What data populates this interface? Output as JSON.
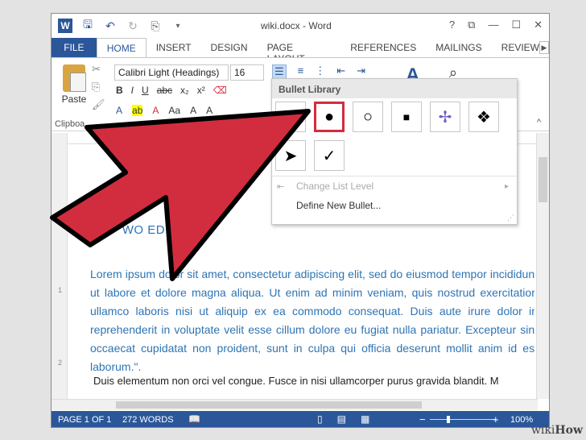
{
  "titlebar": {
    "title": "wiki.docx - Word",
    "help": "?",
    "restore": "⧉",
    "minimize": "—",
    "maximize": "☐",
    "close": "✕"
  },
  "tabs": [
    "FILE",
    "HOME",
    "INSERT",
    "DESIGN",
    "PAGE LAYOUT",
    "REFERENCES",
    "MAILINGS",
    "REVIEW"
  ],
  "ribbon": {
    "paste_label": "Paste",
    "clipboard_label": "Clipboa",
    "font_name": "Calibri Light (Headings)",
    "font_size": "16",
    "format_buttons": [
      "B",
      "I",
      "U",
      "abc",
      "x₂",
      "x²"
    ],
    "format_row2": [
      "A",
      "ab",
      "A",
      "Aa",
      "A",
      "A"
    ]
  },
  "dropdown": {
    "title": "Bullet Library",
    "bullets": [
      "",
      "●",
      "○",
      "■",
      "✢",
      "❖",
      "➤",
      "✓"
    ],
    "selected_index": 1,
    "change_list_level": "Change List Level",
    "define_new_bullet": "Define New Bullet..."
  },
  "document": {
    "heading": "WO        ED",
    "paragraph": "Lorem ipsum dolor sit amet, consectetur adipiscing elit, sed do eiusmod tempor incididunt ut labore et dolore magna aliqua. Ut enim ad minim veniam, quis nostrud exercitation ullamco laboris nisi ut aliquip ex ea commodo consequat. Duis aute irure dolor in reprehenderit in voluptate velit esse cillum dolore eu fugiat nulla pariatur. Excepteur sint occaecat cupidatat non proident, sunt in culpa qui officia deserunt mollit anim id est laborum.\".",
    "paragraph2": "Duis elementum non orci vel congue. Fusce in nisi ullamcorper purus gravida blandit. M"
  },
  "statusbar": {
    "page": "PAGE 1 OF 1",
    "words": "272 WORDS",
    "zoom": "100%",
    "zoom_minus": "−",
    "zoom_plus": "+"
  },
  "watermark": {
    "wiki": "wiki",
    "how": "How"
  },
  "colors": {
    "accent": "#2b579a",
    "arrow": "#d22d3e"
  }
}
